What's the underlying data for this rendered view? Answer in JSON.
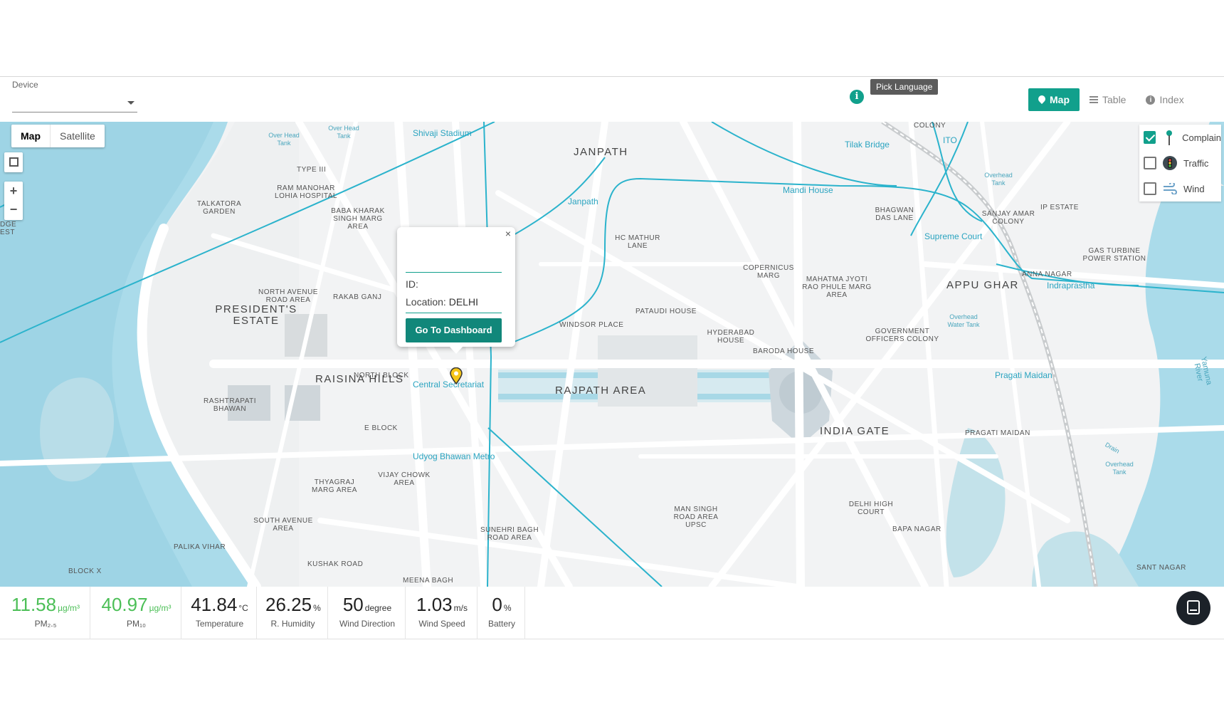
{
  "toolbar": {
    "device_label": "Device",
    "tooltip": "Pick Language",
    "tabs": [
      {
        "label": "Map",
        "active": true
      },
      {
        "label": "Table",
        "active": false
      },
      {
        "label": "Index",
        "active": false
      }
    ],
    "accent_color": "#11a08c"
  },
  "map": {
    "type_buttons": [
      "Map",
      "Satellite"
    ],
    "zoom_in": "+",
    "zoom_out": "−",
    "layers": [
      {
        "label": "Complain",
        "checked": true,
        "icon": "pin-icon"
      },
      {
        "label": "Traffic",
        "checked": false,
        "icon": "traffic-light-icon"
      },
      {
        "label": "Wind",
        "checked": false,
        "icon": "wind-icon"
      }
    ],
    "popup": {
      "close": "×",
      "id_label": "ID:",
      "location_label": "Location:",
      "location_value": "DELHI",
      "button": "Go To Dashboard"
    },
    "labels": {
      "janpath": "JANPATH",
      "presidents_estate": "PRESIDENT'S ESTATE",
      "raisina_hills": "RAISINA HILLS",
      "rajpath_area": "RAJPATH AREA",
      "india_gate": "INDIA GATE",
      "appu_ghar": "APPU GHAR",
      "talkatora": "TALKATORA GARDEN",
      "type_iii": "TYPE III",
      "ram_manohar": "RAM MANOHAR LOHIA HOSPITAL",
      "baba_kharak": "BABA KHARAK SINGH MARG AREA",
      "north_avenue": "NORTH AVENUE ROAD AREA",
      "rakab_ganj": "RAKAB GANJ",
      "north_block": "NORTH BLOCK",
      "rashtrapati": "RASHTRAPATI BHAWAN",
      "e_block": "E BLOCK",
      "thyagraj": "THYAGRAJ MARG AREA",
      "vijay_chowk": "VIJAY CHOWK AREA",
      "south_avenue": "SOUTH AVENUE AREA",
      "palika_vihar": "PALIKA VIHAR",
      "block_x": "BLOCK X",
      "kushak_road": "KUSHAK ROAD",
      "meena_bagh": "MEENA BAGH",
      "sunehri_bagh": "SUNEHRI BAGH ROAD AREA",
      "hc_mathur": "HC MATHUR LANE",
      "windsor": "WINDSOR PLACE",
      "pataudi": "PATAUDI HOUSE",
      "hyderabad": "HYDERABAD HOUSE",
      "baroda": "BARODA HOUSE",
      "copernicus": "COPERNICUS MARG",
      "mahatma": "MAHATMA JYOTI RAO PHULE MARG AREA",
      "govt_officers": "GOVERNMENT OFFICERS COLONY",
      "bhagwan": "BHAGWAN DAS LANE",
      "sanjay_amar": "SANJAY AMAR COLONY",
      "ip_estate": "IP ESTATE",
      "gas_turbine": "GAS TURBINE POWER STATION",
      "anna_nagar": "ANNA NAGAR",
      "pragati_maidan": "PRAGATI MAIDAN",
      "delhi_high_court": "DELHI HIGH COURT",
      "bapa_nagar": "BAPA NAGAR",
      "man_singh": "MAN SINGH ROAD AREA UPSC",
      "sant_nagar": "SANT NAGAR",
      "colony": "COLONY",
      "dge_est": "DGE EST",
      "shivaji_stadium": "Shivaji Stadium",
      "janpath_metro": "Janpath",
      "mandi_house": "Mandi House",
      "tilak_bridge": "Tilak Bridge",
      "ito": "ITO",
      "supreme_court": "Supreme Court",
      "indraprastha": "Indraprastha",
      "pragati_maidan_station": "Pragati Maidan",
      "central_secretariat": "Central Secretariat",
      "udyog_bhawan": "Udyog Bhawan Metro",
      "yamuna": "Yamuna River",
      "drain": "Drain",
      "over_head_tank_1": "Over Head Tank",
      "over_head_tank_2": "Over Head Tank",
      "overhead_tank_3": "Overhead Tank",
      "overhead_water_tank": "Overhead Water Tank",
      "overhead_tank_4": "Overhead Tank"
    },
    "metro_color": "#2bb3cc",
    "water_color": "#aadbea",
    "marker_color": "#f5c518"
  },
  "stats": [
    {
      "value": "11.58",
      "unit": "µg/m³",
      "label": "PM₂.₅",
      "highlight": true
    },
    {
      "value": "40.97",
      "unit": "µg/m³",
      "label": "PM₁₀",
      "highlight": true
    },
    {
      "value": "41.84",
      "unit": "°C",
      "label": "Temperature",
      "highlight": false
    },
    {
      "value": "26.25",
      "unit": "%",
      "label": "R. Humidity",
      "highlight": false
    },
    {
      "value": "50",
      "unit": "degree",
      "label": "Wind Direction",
      "highlight": false
    },
    {
      "value": "1.03",
      "unit": "m/s",
      "label": "Wind Speed",
      "highlight": false
    },
    {
      "value": "0",
      "unit": "%",
      "label": "Battery",
      "highlight": false
    }
  ]
}
